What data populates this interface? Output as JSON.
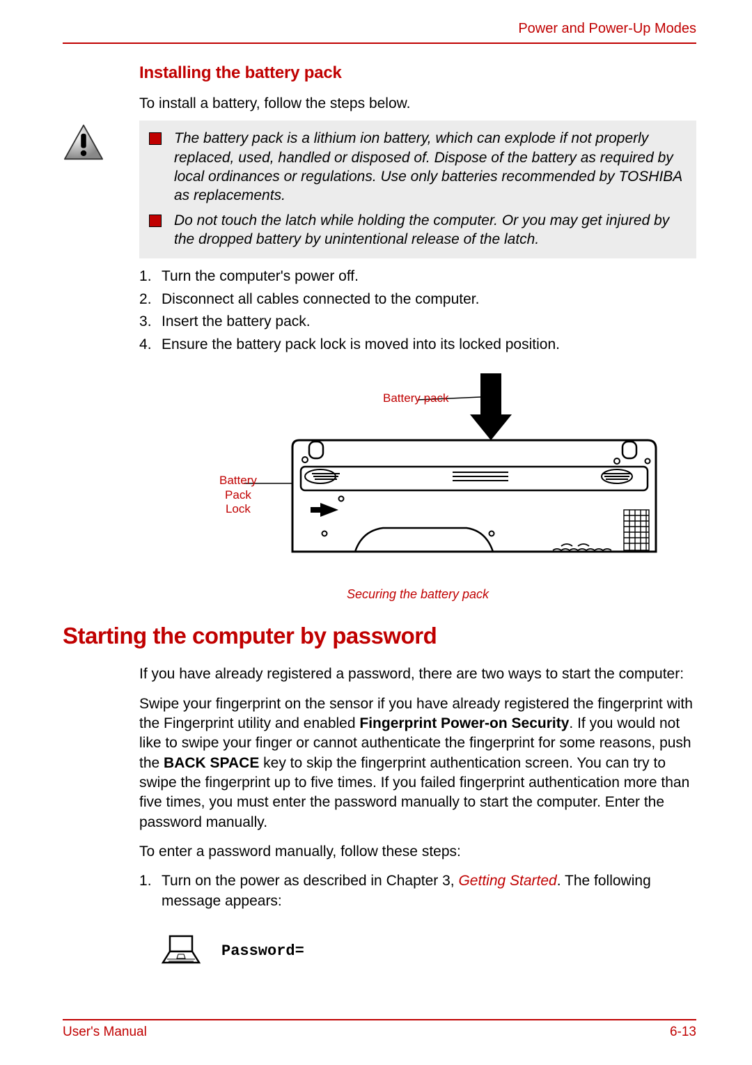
{
  "header": {
    "section": "Power and Power-Up Modes"
  },
  "subheading": "Installing the battery pack",
  "intro": "To install a battery, follow the steps below.",
  "warnings": [
    "The battery pack is a lithium ion battery, which can explode if not properly replaced, used, handled or disposed of. Dispose of the battery as required by local ordinances or regulations. Use only batteries recommended by TOSHIBA as replacements.",
    "Do not touch the latch while holding the computer. Or you may get injured by the dropped battery by unintentional release of the latch."
  ],
  "steps": [
    "Turn the computer's power off.",
    "Disconnect all cables connected to the computer.",
    "Insert the battery pack.",
    "Ensure the battery pack lock is moved into its locked position."
  ],
  "figure": {
    "label_battery_pack": "Battery pack",
    "label_lock_l1": "Battery",
    "label_lock_l2": "Pack",
    "label_lock_l3": "Lock",
    "caption": "Securing the battery pack"
  },
  "main_heading": "Starting the computer by password",
  "para1": "If you have already registered a password, there are two ways to start the computer:",
  "para2_a": "Swipe your fingerprint on the sensor if you have already registered the fingerprint with the Fingerprint utility and enabled ",
  "para2_bold1": "Fingerprint Power-on Security",
  "para2_b": ". If you would not like to swipe your finger or cannot authenticate the fingerprint for some reasons, push the ",
  "para2_bold2": "BACK SPACE",
  "para2_c": " key to skip the fingerprint authentication screen. You can try to swipe the fingerprint up to five times. If you failed fingerprint authentication more than five times, you must enter the password manually to start the computer. Enter the password manually.",
  "para3": "To enter a password manually, follow these steps:",
  "steps2_a": "Turn on the power as described in Chapter 3, ",
  "steps2_link": "Getting Started",
  "steps2_b": ". The following message appears:",
  "prompt": "Password=",
  "footer": {
    "left": "User's Manual",
    "right": "6-13"
  }
}
